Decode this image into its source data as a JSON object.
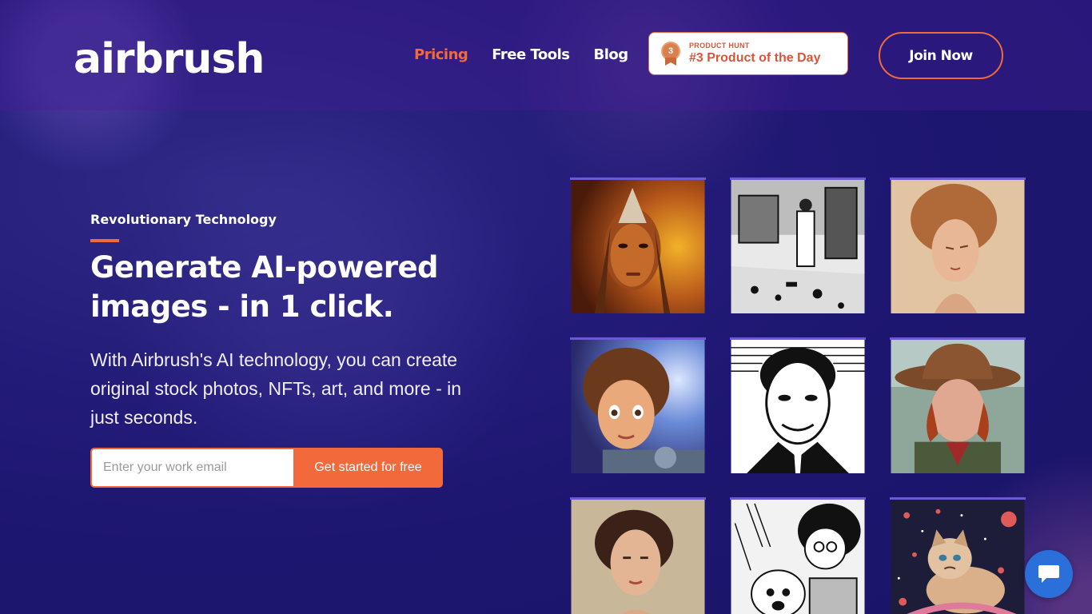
{
  "header": {
    "logo": "airbrush",
    "nav": [
      {
        "label": "Pricing",
        "active": true
      },
      {
        "label": "Free Tools",
        "active": false
      },
      {
        "label": "Blog",
        "active": false
      }
    ],
    "product_hunt": {
      "medal_number": "3",
      "small": "PRODUCT HUNT",
      "big": "#3 Product of the Day"
    },
    "join_label": "Join Now"
  },
  "hero": {
    "eyebrow": "Revolutionary Technology",
    "title": "Generate AI-powered images - in 1 click.",
    "subtitle": "With Airbrush's AI technology, you can create original stock photos, NFTs, art, and more - in just seconds.",
    "email_placeholder": "Enter your work email",
    "cta_label": "Get started for free"
  },
  "gallery": [
    {
      "name": "warrior-portrait",
      "icon": "fantasy-warrior-image"
    },
    {
      "name": "manga-room",
      "icon": "manga-room-image"
    },
    {
      "name": "woman-portrait",
      "icon": "woman-portrait-image"
    },
    {
      "name": "game-hero",
      "icon": "game-character-image"
    },
    {
      "name": "ink-man",
      "icon": "ink-portrait-image"
    },
    {
      "name": "hat-woman",
      "icon": "hat-woman-image"
    },
    {
      "name": "classic-woman",
      "icon": "classic-portrait-image"
    },
    {
      "name": "manga-kids",
      "icon": "manga-kids-image"
    },
    {
      "name": "space-cat",
      "icon": "grumpy-cat-image"
    }
  ],
  "colors": {
    "accent": "#f26a3c",
    "background": "#231b78",
    "chat": "#2b6fdb"
  },
  "chat_icon": "chat-bubble-icon"
}
